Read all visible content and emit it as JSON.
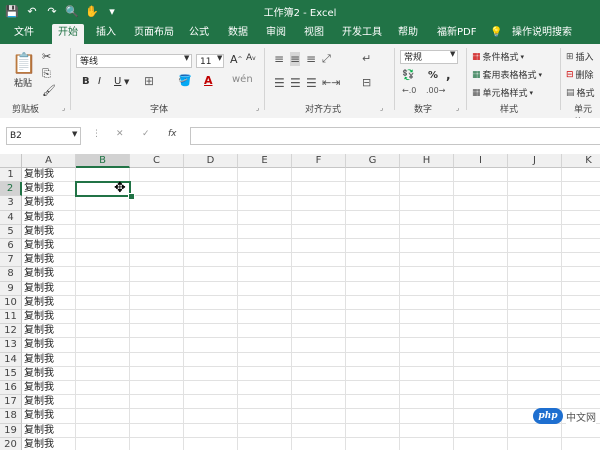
{
  "window": {
    "title": "工作簿2  -  Excel"
  },
  "tabs": [
    "文件",
    "开始",
    "插入",
    "页面布局",
    "公式",
    "数据",
    "审阅",
    "视图",
    "开发工具",
    "帮助",
    "福新PDF",
    "操作说明搜索"
  ],
  "active_tab": "开始",
  "ribbon": {
    "clipboard": {
      "paste": "粘贴",
      "label": "剪贴板"
    },
    "font": {
      "name": "等线",
      "size": "11",
      "label": "字体",
      "bold": "B",
      "italic": "I",
      "underline": "U",
      "grow": "A",
      "shrink": "A"
    },
    "alignment": {
      "label": "对齐方式"
    },
    "number": {
      "format": "常规",
      "label": "数字",
      "percent": "%",
      "comma": ","
    },
    "styles": {
      "cond": "条件格式",
      "table": "套用表格格式",
      "cell": "单元格样式",
      "label": "样式"
    },
    "cells": {
      "insert": "插入",
      "delete": "删除",
      "format": "格式",
      "label": "单元格"
    }
  },
  "formula_bar": {
    "name_box": "B2",
    "fx": "fx",
    "cancel": "✕",
    "enter": "✓",
    "value": ""
  },
  "columns": [
    "A",
    "B",
    "C",
    "D",
    "E",
    "F",
    "G",
    "H",
    "I",
    "J",
    "K"
  ],
  "selected_column": "B",
  "rows": [
    "1",
    "2",
    "3",
    "4",
    "5",
    "6",
    "7",
    "8",
    "9",
    "10",
    "11",
    "12",
    "13",
    "14",
    "15",
    "16",
    "17",
    "18",
    "19",
    "20"
  ],
  "selected_row": "2",
  "column_a_values": [
    "复制我",
    "复制我",
    "复制我",
    "复制我",
    "复制我",
    "复制我",
    "复制我",
    "复制我",
    "复制我",
    "复制我",
    "复制我",
    "复制我",
    "复制我",
    "复制我",
    "复制我",
    "复制我",
    "复制我",
    "复制我",
    "复制我",
    "复制我"
  ],
  "watermark": {
    "logo": "php",
    "text": "中文网"
  },
  "colors": {
    "accent": "#217346",
    "ribbon_bg": "#f3f3f3",
    "watermark_blue": "#1e6fd0"
  }
}
